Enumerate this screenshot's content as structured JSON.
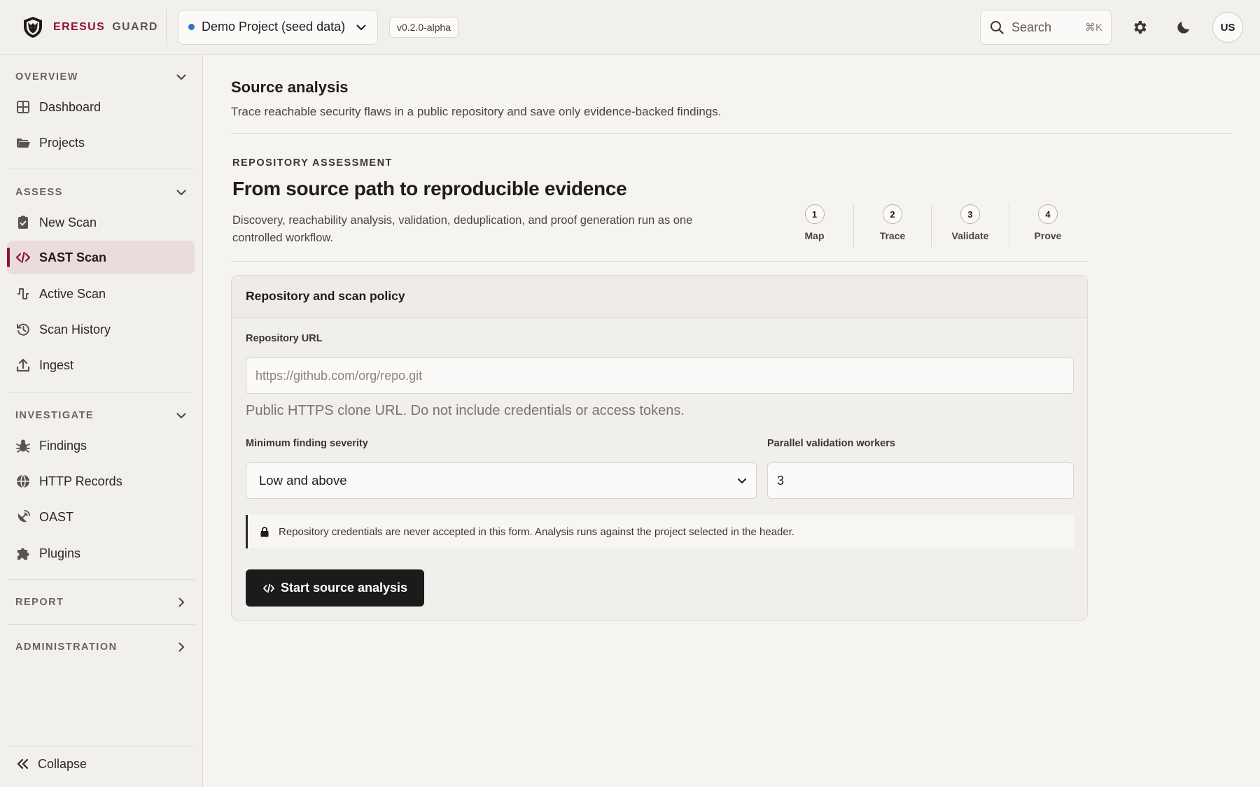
{
  "app": {
    "brand_primary": "ERESUS",
    "brand_secondary": "GUARD",
    "project": "Demo Project (seed data)",
    "version": "v0.2.0-alpha",
    "search_label": "Search",
    "search_shortcut": "⌘K",
    "avatar_initials": "US",
    "colors": {
      "accent": "#8e1430",
      "project_dot": "#2c73c9",
      "primary_button": "#1c1b1b"
    }
  },
  "sidebar": {
    "sections": [
      {
        "title": "OVERVIEW",
        "expanded": true,
        "items": [
          {
            "label": "Dashboard",
            "icon": "grid-icon"
          },
          {
            "label": "Projects",
            "icon": "folder-open-icon"
          }
        ]
      },
      {
        "title": "ASSESS",
        "expanded": true,
        "items": [
          {
            "label": "New Scan",
            "icon": "clipboard-check-icon"
          },
          {
            "label": "SAST Scan",
            "icon": "code-icon",
            "active": true
          },
          {
            "label": "Active Scan",
            "icon": "pulse-icon"
          },
          {
            "label": "Scan History",
            "icon": "history-icon"
          },
          {
            "label": "Ingest",
            "icon": "upload-icon"
          }
        ]
      },
      {
        "title": "INVESTIGATE",
        "expanded": true,
        "items": [
          {
            "label": "Findings",
            "icon": "bug-icon"
          },
          {
            "label": "HTTP Records",
            "icon": "globe-icon"
          },
          {
            "label": "OAST",
            "icon": "satellite-icon"
          },
          {
            "label": "Plugins",
            "icon": "puzzle-icon"
          }
        ]
      },
      {
        "title": "REPORT",
        "expanded": false,
        "items": []
      },
      {
        "title": "ADMINISTRATION",
        "expanded": false,
        "items": []
      }
    ],
    "collapse_label": "Collapse"
  },
  "main": {
    "title": "Source analysis",
    "subtitle": "Trace reachable security flaws in a public repository and save only evidence-backed findings.",
    "hero": {
      "eyebrow": "REPOSITORY ASSESSMENT",
      "title": "From source path to reproducible evidence",
      "description": "Discovery, reachability analysis, validation, deduplication, and proof generation run as one controlled workflow.",
      "steps": [
        {
          "num": "1",
          "label": "Map"
        },
        {
          "num": "2",
          "label": "Trace"
        },
        {
          "num": "3",
          "label": "Validate"
        },
        {
          "num": "4",
          "label": "Prove"
        }
      ]
    },
    "form": {
      "card_title": "Repository and scan policy",
      "repo_label": "Repository URL",
      "repo_placeholder": "https://github.com/org/repo.git",
      "repo_value": "",
      "repo_help": "Public HTTPS clone URL. Do not include credentials or access tokens.",
      "severity_label": "Minimum finding severity",
      "severity_value": "Low and above",
      "workers_label": "Parallel validation workers",
      "workers_value": "3",
      "notice": "Repository credentials are never accepted in this form. Analysis runs against the project selected in the header.",
      "submit_label": "Start source analysis"
    }
  }
}
